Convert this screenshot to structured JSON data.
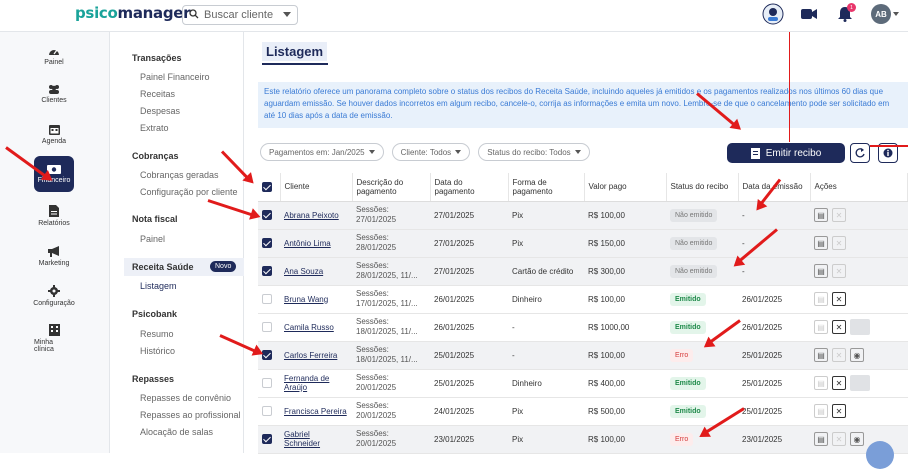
{
  "brand": {
    "prefix": "psico",
    "suffix": "manager"
  },
  "search": {
    "label": "Buscar cliente"
  },
  "topbar": {
    "avatar": "AB",
    "notifications": "1"
  },
  "rail": [
    {
      "label": "Painel",
      "icon": "gauge-icon"
    },
    {
      "label": "Clientes",
      "icon": "users-icon"
    },
    {
      "label": "Agenda",
      "icon": "calendar-icon"
    },
    {
      "label": "Financeiro",
      "icon": "money-icon",
      "active": true
    },
    {
      "label": "Relatórios",
      "icon": "document-icon"
    },
    {
      "label": "Marketing",
      "icon": "megaphone-icon"
    },
    {
      "label": "Configuração",
      "icon": "gear-icon"
    },
    {
      "label": "Minha clínica",
      "icon": "building-icon"
    }
  ],
  "submenu": {
    "transacoes": "Transações",
    "painel_financeiro": "Painel Financeiro",
    "receitas": "Receitas",
    "despesas": "Despesas",
    "extrato": "Extrato",
    "cobrancas": "Cobranças",
    "cobrancas_geradas": "Cobranças geradas",
    "configuracao_cliente": "Configuração por cliente",
    "nota_fiscal": "Nota fiscal",
    "nf_painel": "Painel",
    "receita_saude": "Receita Saúde",
    "novo": "Novo",
    "listagem": "Listagem",
    "psicobank": "Psicobank",
    "resumo": "Resumo",
    "historico": "Histórico",
    "repasses": "Repasses",
    "repasses_convenio": "Repasses de convênio",
    "repasses_profissional": "Repasses ao profissional",
    "alocacao_salas": "Alocação de salas"
  },
  "page": {
    "title": "Listagem",
    "info": "Este relatório oferece um panorama completo sobre o status dos recibos do Receita Saúde, incluindo aqueles já emitidos e os pagamentos realizados nos últimos 60 dias que aguardam emissão. Se houver dados incorretos em algum recibo, cancele-o, corrija as informações e emita um novo. Lembre-se de que o cancelamento pode ser solicitado em até 10 dias após a data de emissão.",
    "filter_payments": "Pagamentos em: Jan/2025",
    "filter_client": "Cliente: Todos",
    "filter_status": "Status do recibo: Todos",
    "emit_button": "Emitir recibo"
  },
  "table": {
    "headers": [
      "Cliente",
      "Descrição do pagamento",
      "Data do pagamento",
      "Forma de pagamento",
      "Valor pago",
      "Status do recibo",
      "Data da emissão",
      "Ações"
    ],
    "rows": [
      {
        "checked": true,
        "cliente": "Abrana Peixoto",
        "desc": "Sessões: 27/01/2025",
        "data": "27/01/2025",
        "forma": "Pix",
        "valor": "R$ 100,00",
        "status": "Não emitido",
        "emissao": "-"
      },
      {
        "checked": true,
        "cliente": "Antônio Lima",
        "desc": "Sessões: 28/01/2025",
        "data": "27/01/2025",
        "forma": "Pix",
        "valor": "R$ 150,00",
        "status": "Não emitido",
        "emissao": "-"
      },
      {
        "checked": true,
        "cliente": "Ana Souza",
        "desc": "Sessões: 28/01/2025, 11/...",
        "data": "27/01/2025",
        "forma": "Cartão de crédito",
        "valor": "R$ 300,00",
        "status": "Não emitido",
        "emissao": "-"
      },
      {
        "checked": false,
        "cliente": "Bruna Wang",
        "desc": "Sessões: 17/01/2025, 11/...",
        "data": "26/01/2025",
        "forma": "Dinheiro",
        "valor": "R$ 100,00",
        "status": "Emitido",
        "emissao": "26/01/2025"
      },
      {
        "checked": false,
        "cliente": "Camila Russo",
        "desc": "Sessões: 18/01/2025, 11/...",
        "data": "26/01/2025",
        "forma": "-",
        "valor": "R$ 1000,00",
        "status": "Emitido",
        "emissao": "26/01/2025"
      },
      {
        "checked": true,
        "cliente": "Carlos Ferreira",
        "desc": "Sessões: 18/01/2025, 11/...",
        "data": "25/01/2025",
        "forma": "-",
        "valor": "R$ 100,00",
        "status": "Erro",
        "emissao": "25/01/2025"
      },
      {
        "checked": false,
        "cliente": "Fernanda de Araújo",
        "desc": "Sessões: 20/01/2025",
        "data": "25/01/2025",
        "forma": "Dinheiro",
        "valor": "R$ 400,00",
        "status": "Emitido",
        "emissao": "25/01/2025"
      },
      {
        "checked": false,
        "cliente": "Francisca Pereira",
        "desc": "Sessões: 20/01/2025",
        "data": "24/01/2025",
        "forma": "Pix",
        "valor": "R$ 500,00",
        "status": "Emitido",
        "emissao": "25/01/2025"
      },
      {
        "checked": true,
        "cliente": "Gabriel Schneider",
        "desc": "Sessões: 20/01/2025",
        "data": "23/01/2025",
        "forma": "Pix",
        "valor": "R$ 100,00",
        "status": "Erro",
        "emissao": "23/01/2025"
      }
    ]
  },
  "colors": {
    "brand": "#1e2a5a",
    "accent": "#1aa39a",
    "annotation": "#e11b1b"
  }
}
